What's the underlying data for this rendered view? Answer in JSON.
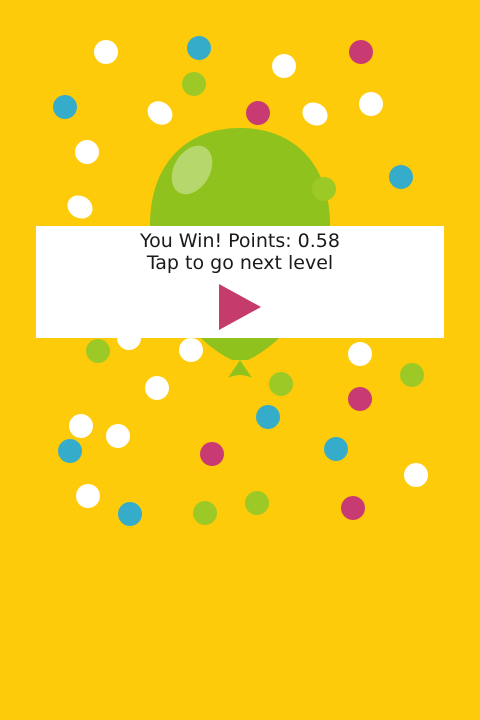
{
  "screen": {
    "background_color": "#fecb0a"
  },
  "win_dialog": {
    "result_prefix": "You Win! Points: ",
    "points": "0.58",
    "instruction": "Tap to go next level",
    "play_button_icon": "play-triangle-icon",
    "play_button_color": "#c53b6b"
  },
  "balloon": {
    "icon": "balloon-icon",
    "color": "#8fc21c",
    "state": "popped-win"
  },
  "confetti_colors": {
    "white": "#ffffff",
    "cyan": "#35acc9",
    "magenta": "#c83b72",
    "lime": "#9cc925"
  }
}
